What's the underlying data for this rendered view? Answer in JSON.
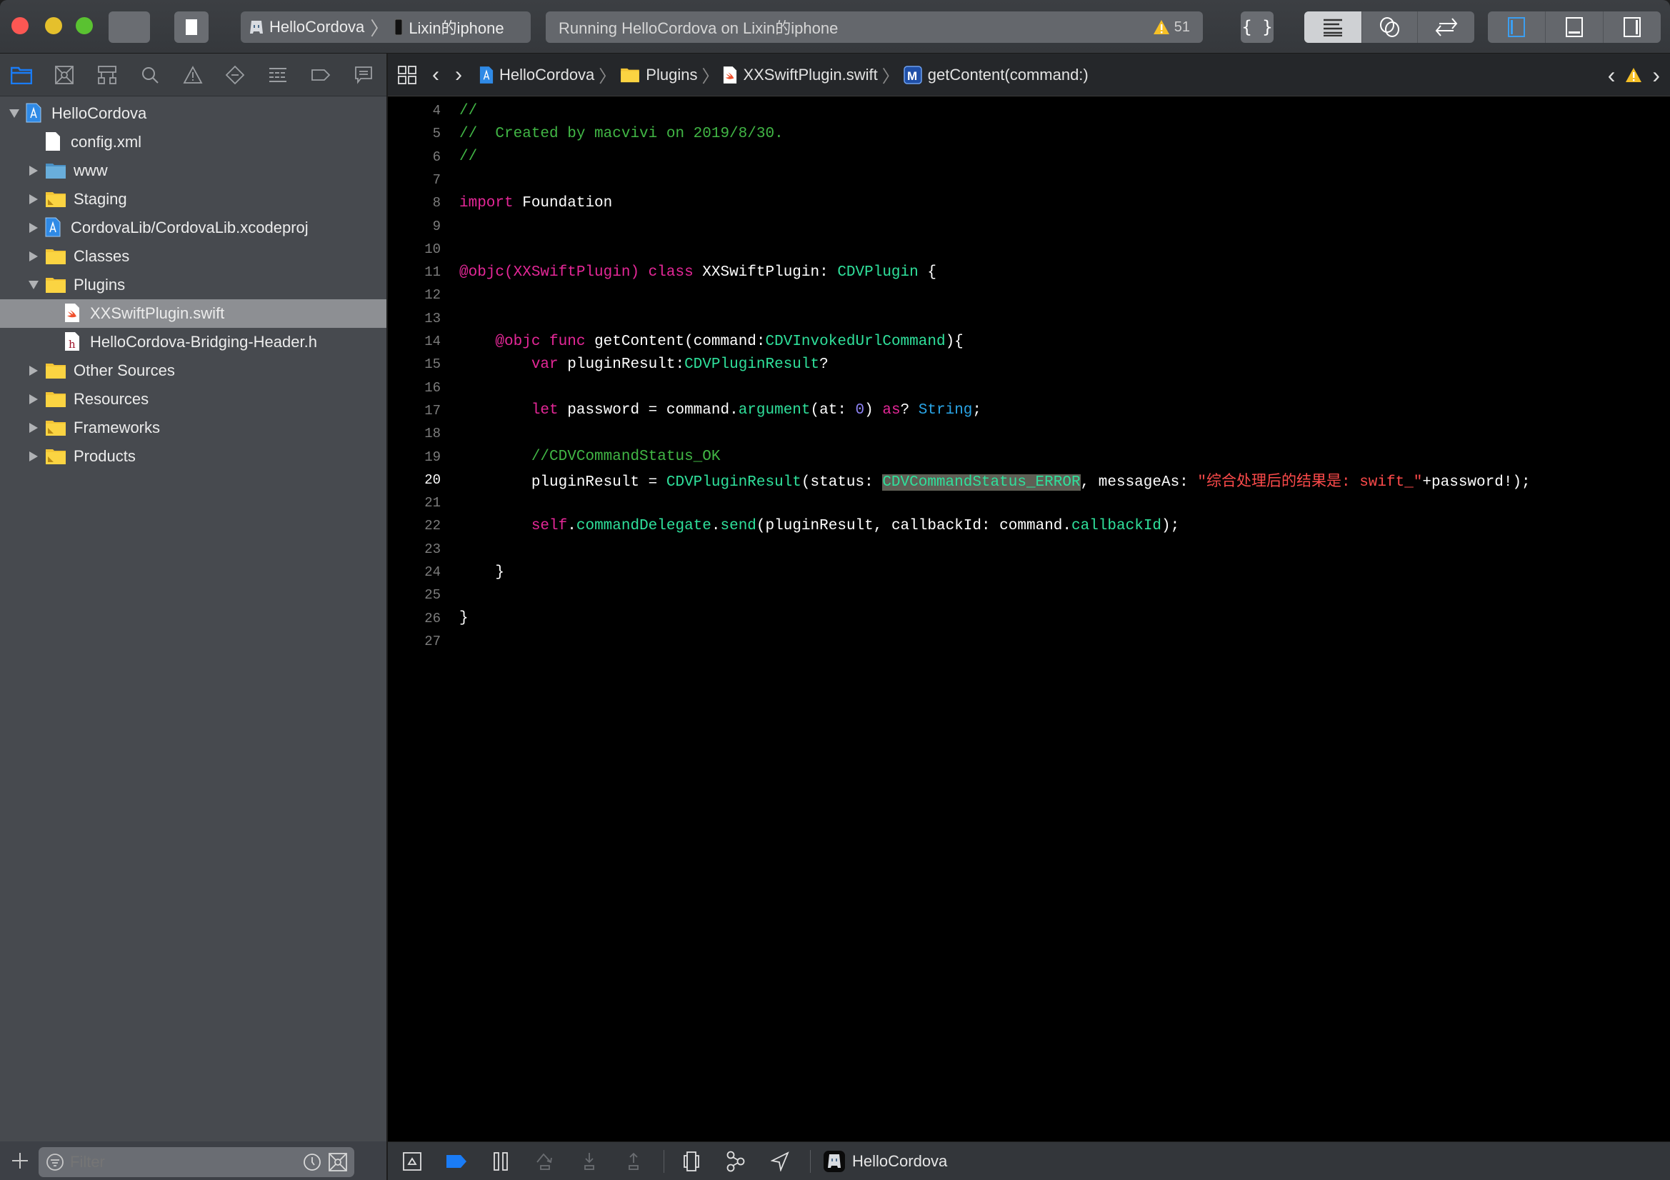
{
  "window": {
    "run_button": "run",
    "stop_button": "stop",
    "scheme": {
      "target": "HelloCordova",
      "device": "Lixin的iphone"
    },
    "activity_status": "Running HelloCordova on Lixin的iphone",
    "warning_count": "51",
    "editor_modes": [
      "standard",
      "assistant",
      "version"
    ],
    "view_toggles": [
      "navigator",
      "debug-area",
      "utilities"
    ],
    "active_view_toggle": "navigator",
    "active_editor_mode": "standard"
  },
  "navigator": {
    "tabs": [
      "project",
      "source-control",
      "symbol",
      "find",
      "issue",
      "test",
      "debug",
      "breakpoint",
      "report"
    ],
    "active_tab": "project",
    "tree": [
      {
        "label": "HelloCordova",
        "kind": "project",
        "depth": 0,
        "disclosure": "open"
      },
      {
        "label": "config.xml",
        "kind": "file-plain",
        "depth": 1,
        "disclosure": "none"
      },
      {
        "label": "www",
        "kind": "folder-blue",
        "depth": 1,
        "disclosure": "closed"
      },
      {
        "label": "Staging",
        "kind": "folder-group",
        "depth": 1,
        "disclosure": "closed"
      },
      {
        "label": "CordovaLib/CordovaLib.xcodeproj",
        "kind": "project",
        "depth": 1,
        "disclosure": "closed"
      },
      {
        "label": "Classes",
        "kind": "folder",
        "depth": 1,
        "disclosure": "closed"
      },
      {
        "label": "Plugins",
        "kind": "folder",
        "depth": 1,
        "disclosure": "open"
      },
      {
        "label": "XXSwiftPlugin.swift",
        "kind": "file-swift",
        "depth": 2,
        "disclosure": "none",
        "selected": true
      },
      {
        "label": "HelloCordova-Bridging-Header.h",
        "kind": "file-h",
        "depth": 2,
        "disclosure": "none"
      },
      {
        "label": "Other Sources",
        "kind": "folder",
        "depth": 1,
        "disclosure": "closed"
      },
      {
        "label": "Resources",
        "kind": "folder",
        "depth": 1,
        "disclosure": "closed"
      },
      {
        "label": "Frameworks",
        "kind": "folder-group",
        "depth": 1,
        "disclosure": "closed"
      },
      {
        "label": "Products",
        "kind": "folder-group",
        "depth": 1,
        "disclosure": "closed"
      }
    ],
    "filter": {
      "placeholder": "Filter",
      "value": ""
    }
  },
  "jumpbar": {
    "crumbs": [
      {
        "label": "HelloCordova",
        "icon": "project-icon"
      },
      {
        "label": "Plugins",
        "icon": "folder-icon"
      },
      {
        "label": "XXSwiftPlugin.swift",
        "icon": "swift-file-icon"
      },
      {
        "label": "getContent(command:)",
        "icon": "method-icon",
        "badge": "M"
      }
    ]
  },
  "editor": {
    "current_line": 20,
    "lines": [
      {
        "n": 4,
        "tokens": [
          [
            "c-comment",
            "//"
          ]
        ]
      },
      {
        "n": 5,
        "tokens": [
          [
            "c-comment",
            "//  Created by macvivi on 2019/8/30."
          ]
        ]
      },
      {
        "n": 6,
        "tokens": [
          [
            "c-comment",
            "//"
          ]
        ]
      },
      {
        "n": 7,
        "tokens": []
      },
      {
        "n": 8,
        "tokens": [
          [
            "c-kw",
            "import"
          ],
          [
            "c-plain",
            " Foundation"
          ]
        ]
      },
      {
        "n": 9,
        "tokens": []
      },
      {
        "n": 10,
        "tokens": []
      },
      {
        "n": 11,
        "tokens": [
          [
            "c-kw",
            "@objc(XXSwiftPlugin)"
          ],
          [
            "c-plain",
            " "
          ],
          [
            "c-kw",
            "class"
          ],
          [
            "c-plain",
            " XXSwiftPlugin: "
          ],
          [
            "c-type",
            "CDVPlugin"
          ],
          [
            "c-plain",
            " {"
          ]
        ]
      },
      {
        "n": 12,
        "tokens": []
      },
      {
        "n": 13,
        "tokens": []
      },
      {
        "n": 14,
        "tokens": [
          [
            "c-plain",
            "    "
          ],
          [
            "c-kw",
            "@objc"
          ],
          [
            "c-plain",
            " "
          ],
          [
            "c-kw",
            "func"
          ],
          [
            "c-plain",
            " getContent(command:"
          ],
          [
            "c-type",
            "CDVInvokedUrlCommand"
          ],
          [
            "c-plain",
            "){"
          ]
        ]
      },
      {
        "n": 15,
        "tokens": [
          [
            "c-plain",
            "        "
          ],
          [
            "c-kw",
            "var"
          ],
          [
            "c-plain",
            " pluginResult:"
          ],
          [
            "c-type",
            "CDVPluginResult"
          ],
          [
            "c-plain",
            "?"
          ]
        ]
      },
      {
        "n": 16,
        "tokens": []
      },
      {
        "n": 17,
        "tokens": [
          [
            "c-plain",
            "        "
          ],
          [
            "c-kw",
            "let"
          ],
          [
            "c-plain",
            " password = command."
          ],
          [
            "c-type",
            "argument"
          ],
          [
            "c-plain",
            "(at: "
          ],
          [
            "c-num",
            "0"
          ],
          [
            "c-plain",
            ") "
          ],
          [
            "c-kw",
            "as"
          ],
          [
            "c-plain",
            "? "
          ],
          [
            "c-std",
            "String"
          ],
          [
            "c-plain",
            ";"
          ]
        ]
      },
      {
        "n": 18,
        "tokens": []
      },
      {
        "n": 19,
        "tokens": [
          [
            "c-plain",
            "        "
          ],
          [
            "c-comment",
            "//CDVCommandStatus_OK"
          ]
        ]
      },
      {
        "n": 20,
        "tokens": [
          [
            "c-plain",
            "        pluginResult = "
          ],
          [
            "c-type",
            "CDVPluginResult"
          ],
          [
            "c-plain",
            "(status: "
          ],
          [
            "c-type hl",
            "CDVCommandStatus_ERROR"
          ],
          [
            "c-plain",
            ", messageAs: "
          ],
          [
            "c-str",
            "\"综合处理后的结果是: swift_\""
          ],
          [
            "c-plain",
            "+password!);"
          ]
        ]
      },
      {
        "n": 21,
        "tokens": []
      },
      {
        "n": 22,
        "tokens": [
          [
            "c-plain",
            "        "
          ],
          [
            "c-kw",
            "self"
          ],
          [
            "c-plain",
            "."
          ],
          [
            "c-type",
            "commandDelegate"
          ],
          [
            "c-plain",
            "."
          ],
          [
            "c-type",
            "send"
          ],
          [
            "c-plain",
            "(pluginResult, callbackId: command."
          ],
          [
            "c-type",
            "callbackId"
          ],
          [
            "c-plain",
            ");"
          ]
        ]
      },
      {
        "n": 23,
        "tokens": []
      },
      {
        "n": 24,
        "tokens": [
          [
            "c-plain",
            "    }"
          ]
        ]
      },
      {
        "n": 25,
        "tokens": []
      },
      {
        "n": 26,
        "tokens": [
          [
            "c-plain",
            "}"
          ]
        ]
      },
      {
        "n": 27,
        "tokens": []
      }
    ]
  },
  "debugbar": {
    "process_name": "HelloCordova",
    "buttons": [
      "hide-debug-area",
      "breakpoints-toggle",
      "pause-continue",
      "step-over",
      "step-into",
      "step-out",
      "view-hierarchy",
      "memory-graph",
      "simulate-location"
    ]
  },
  "colors": {
    "accent": "#1a7cf6",
    "warning": "#f6c026",
    "comment": "#41b645",
    "keyword": "#e42797",
    "project_type": "#2fe09b",
    "std_type": "#2aa6e8",
    "string": "#fc4a4a",
    "number": "#8d82f2"
  }
}
